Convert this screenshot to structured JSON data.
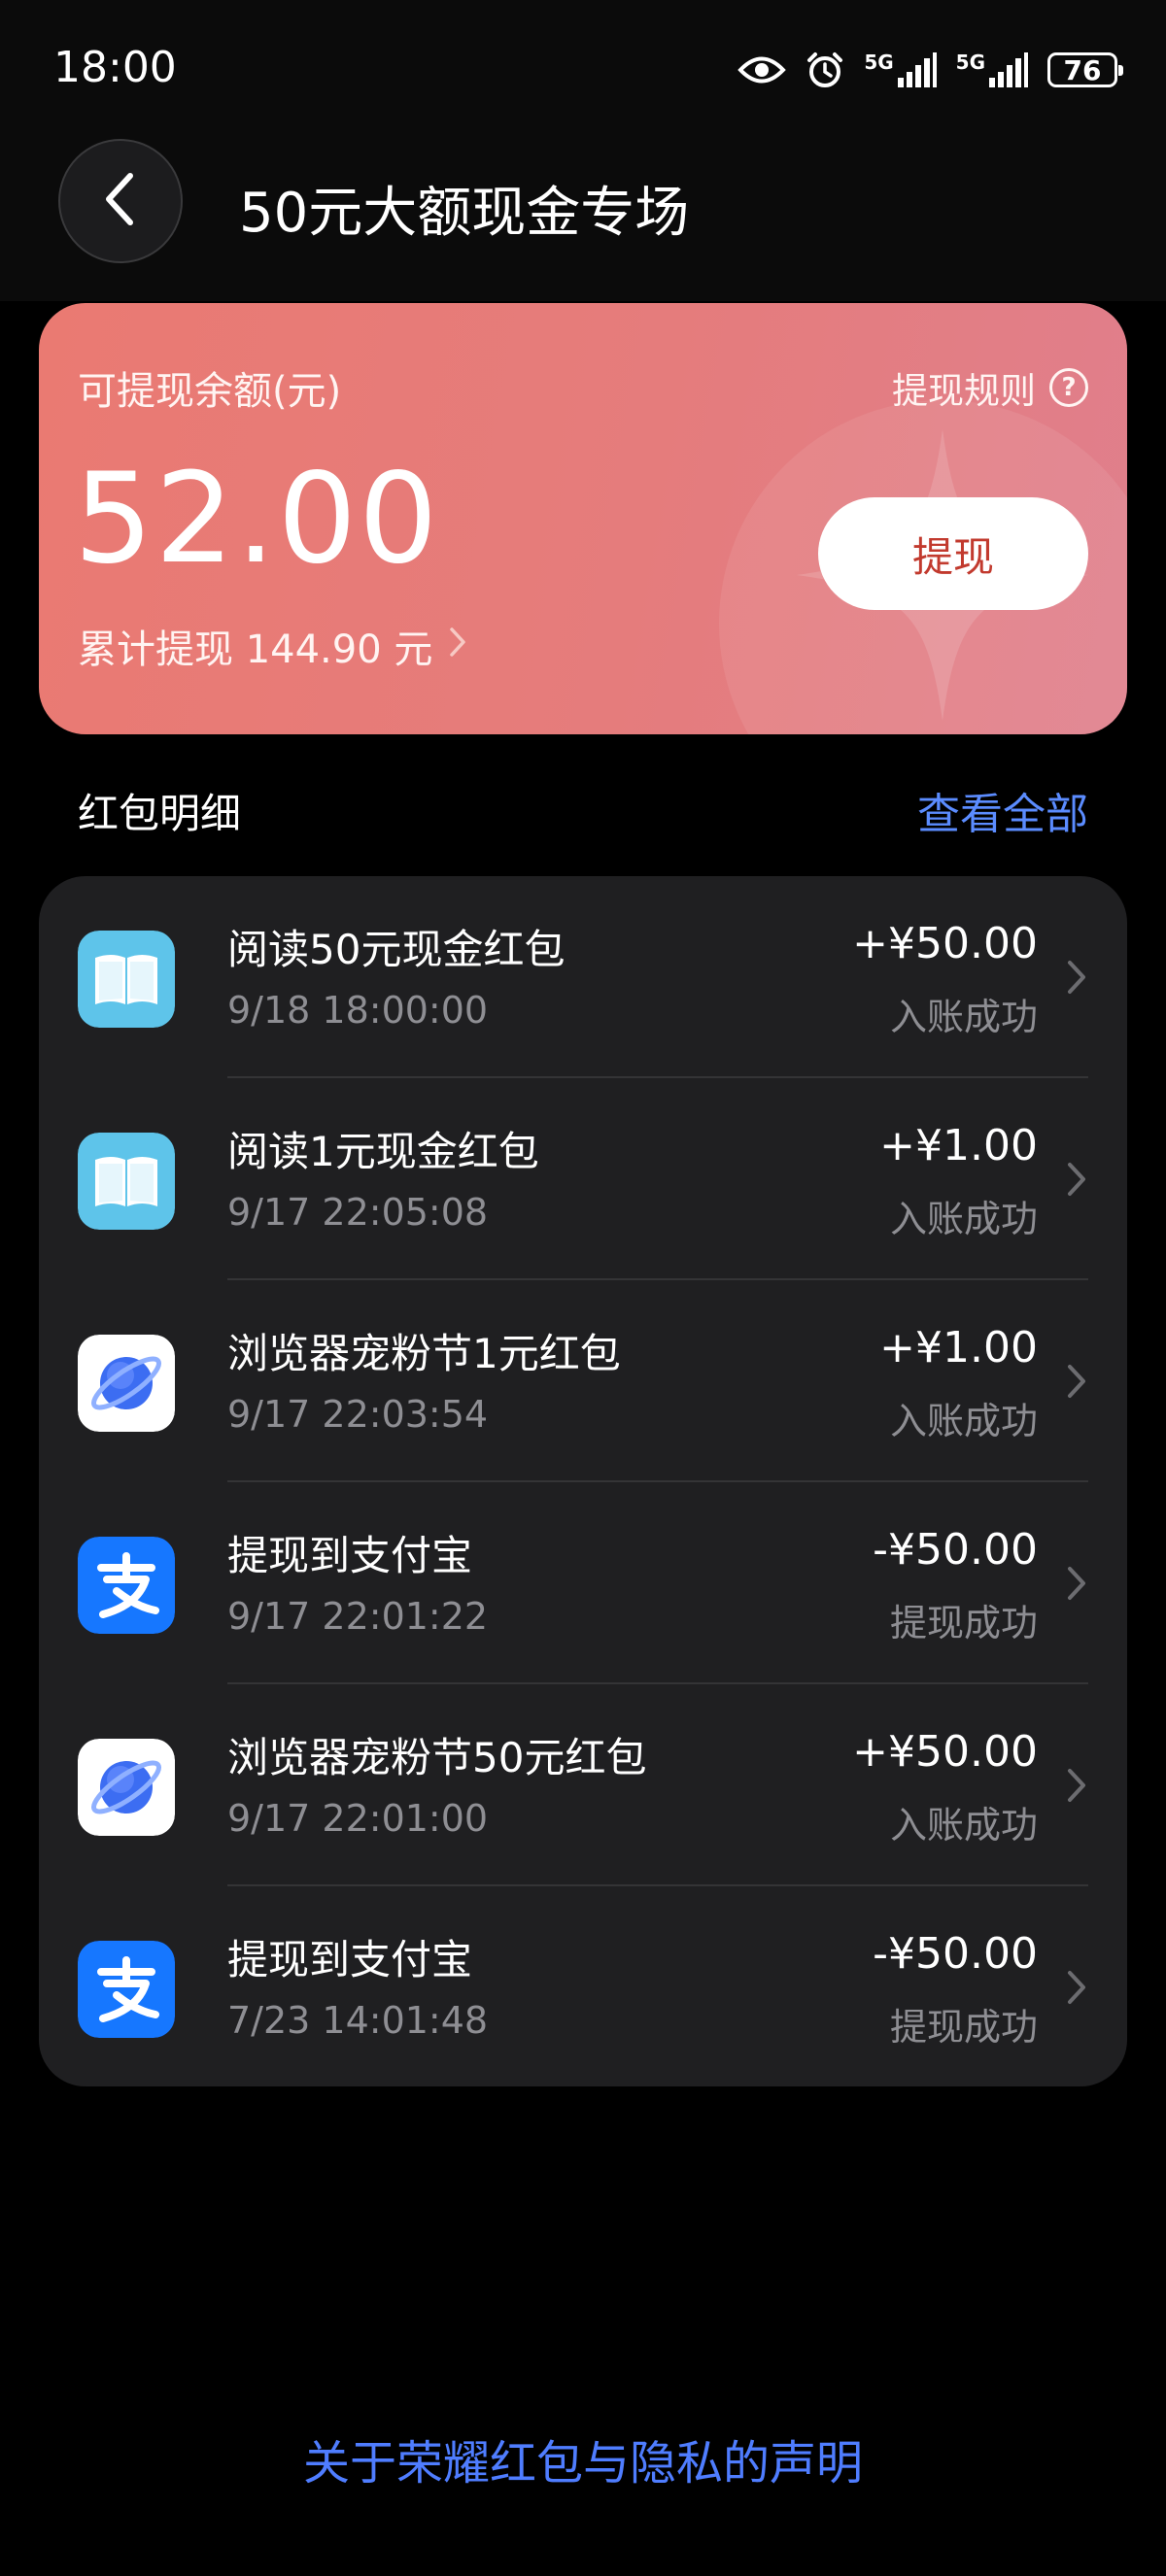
{
  "status_bar": {
    "time": "18:00",
    "signal_1_label": "5G",
    "signal_2_label": "5G",
    "battery_level": "76"
  },
  "header": {
    "title": "50元大额现金专场"
  },
  "balance_card": {
    "label": "可提现余额(元)",
    "rules_label": "提现规则",
    "amount": "52.00",
    "withdraw_label": "提现",
    "cumulative_text": "累计提现 144.90 元"
  },
  "section": {
    "title": "红包明细",
    "view_all_label": "查看全部"
  },
  "items": [
    {
      "icon": "book-icon",
      "title": "阅读50元现金红包",
      "time": "9/18 18:00:00",
      "amount": "+¥50.00",
      "status": "入账成功"
    },
    {
      "icon": "book-icon",
      "title": "阅读1元现金红包",
      "time": "9/17 22:05:08",
      "amount": "+¥1.00",
      "status": "入账成功"
    },
    {
      "icon": "browser-planet-icon",
      "title": "浏览器宠粉节1元红包",
      "time": "9/17 22:03:54",
      "amount": "+¥1.00",
      "status": "入账成功"
    },
    {
      "icon": "alipay-icon",
      "title": "提现到支付宝",
      "time": "9/17 22:01:22",
      "amount": "-¥50.00",
      "status": "提现成功"
    },
    {
      "icon": "browser-planet-icon",
      "title": "浏览器宠粉节50元红包",
      "time": "9/17 22:01:00",
      "amount": "+¥50.00",
      "status": "入账成功"
    },
    {
      "icon": "alipay-icon",
      "title": "提现到支付宝",
      "time": "7/23 14:01:48",
      "amount": "-¥50.00",
      "status": "提现成功"
    }
  ],
  "footer": {
    "privacy_label": "关于荣耀红包与隐私的声明"
  },
  "colors": {
    "card_gradient_start": "#ea7a72",
    "card_gradient_end": "#e07f8c",
    "link_blue": "#5b8cff",
    "list_bg": "#1f1f21",
    "alipay_blue": "#1677ff"
  }
}
